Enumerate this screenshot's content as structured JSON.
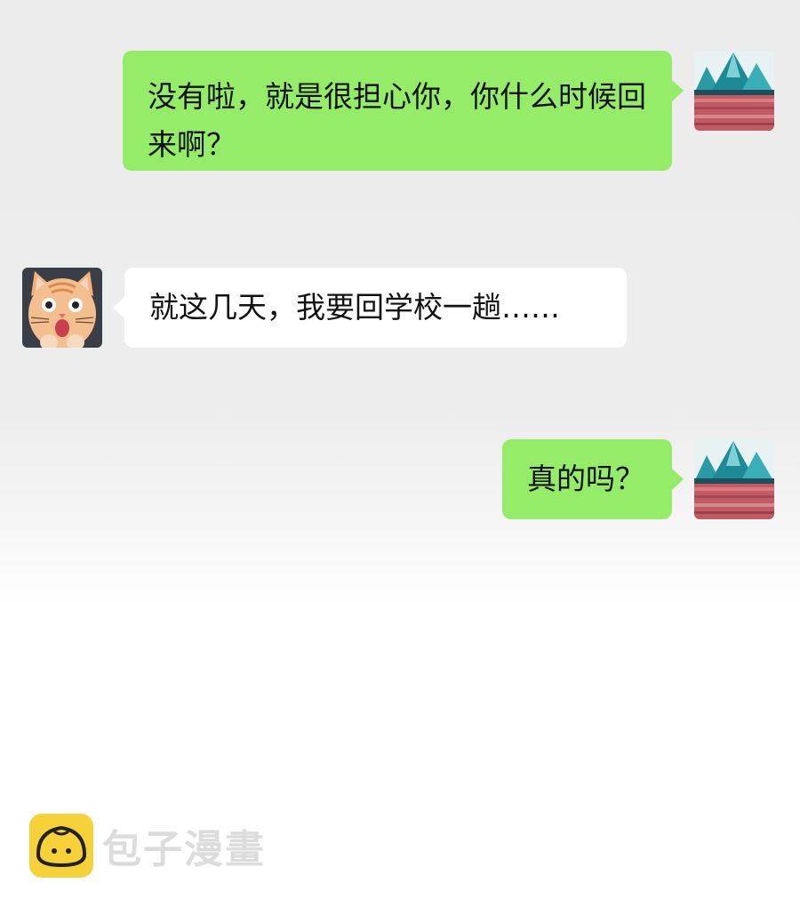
{
  "messages": [
    {
      "side": "sent",
      "avatar": "mountain-landscape-avatar",
      "text": "没有啦，就是很担心你，你什么时候回来啊？"
    },
    {
      "side": "received",
      "avatar": "cat-avatar",
      "text": "就这几天，我要回学校一趟……"
    },
    {
      "side": "sent",
      "avatar": "mountain-landscape-avatar",
      "text": "真的吗？"
    }
  ],
  "watermark": {
    "icon": "bun-logo-icon",
    "text": "包子漫畫"
  },
  "colors": {
    "sent_bubble": "#95ec69",
    "received_bubble": "#ffffff",
    "background": "#ededed"
  }
}
